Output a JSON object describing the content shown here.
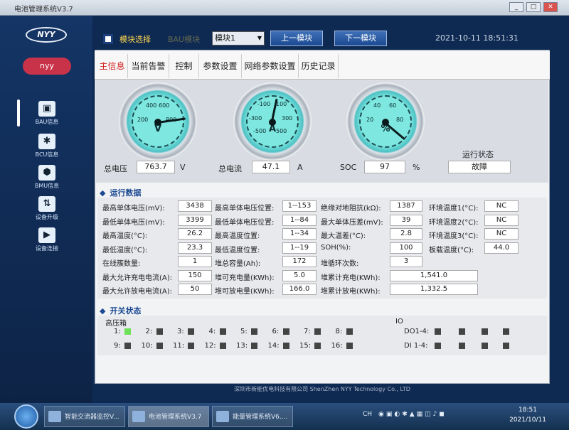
{
  "window": {
    "title": "电池管理系统V3.7"
  },
  "sidebar": {
    "logo": "NYY",
    "user": "nyy",
    "items": [
      {
        "label": "BAU信息",
        "icon": "cube-icon",
        "glyph": "▣"
      },
      {
        "label": "BCU信息",
        "icon": "molecule-icon",
        "glyph": "✱"
      },
      {
        "label": "BMU信息",
        "icon": "hexagon-cluster-icon",
        "glyph": "⬢"
      },
      {
        "label": "设备升级",
        "icon": "upgrade-arrows-icon",
        "glyph": "⇅"
      },
      {
        "label": "设备连接",
        "icon": "connect-icon",
        "glyph": "▶"
      }
    ]
  },
  "topbar": {
    "module_select_label": "模块选择",
    "bau_label": "BAU模块",
    "module_value": "模块1",
    "prev_button": "上一模块",
    "next_button": "下一模块",
    "datetime": "2021-10-11  18:51:31"
  },
  "tabs": [
    "主信息",
    "当前告警",
    "控制",
    "参数设置",
    "网络参数设置",
    "历史记录"
  ],
  "gauges": {
    "voltage": {
      "label": "总电压",
      "value": "763.7",
      "unit": "V",
      "gauge_unit": "V",
      "ticks": [
        "400",
        "600",
        "200",
        "800"
      ]
    },
    "current": {
      "label": "总电流",
      "value": "47.1",
      "unit": "A",
      "gauge_unit": "A",
      "ticks": [
        "-100",
        "100",
        "-300",
        "300",
        "-500",
        "500"
      ]
    },
    "soc": {
      "label": "SOC",
      "value": "97",
      "unit": "%",
      "gauge_unit": "%",
      "ticks": [
        "40",
        "60",
        "20",
        "80"
      ]
    },
    "status": {
      "label": "运行状态",
      "value": "故障"
    }
  },
  "run_data": {
    "title": "运行数据",
    "rows": [
      [
        {
          "l": "最高单体电压(mV):",
          "v": "3438"
        },
        {
          "l": "最高单体电压位置:",
          "v": "1--153"
        },
        {
          "l": "绝缘对地阻抗(kΩ):",
          "v": "1387"
        },
        {
          "l": "环境温度1(°C):",
          "v": "NC"
        }
      ],
      [
        {
          "l": "最低单体电压(mV):",
          "v": "3399"
        },
        {
          "l": "最低单体电压位置:",
          "v": "1--84"
        },
        {
          "l": "最大单体压差(mV):",
          "v": "39"
        },
        {
          "l": "环境温度2(°C):",
          "v": "NC"
        }
      ],
      [
        {
          "l": "最高温度(°C):",
          "v": "26.2"
        },
        {
          "l": "最高温度位置:",
          "v": "1--34"
        },
        {
          "l": "最大温差(°C):",
          "v": "2.8"
        },
        {
          "l": "环境温度3(°C):",
          "v": "NC"
        }
      ],
      [
        {
          "l": "最低温度(°C):",
          "v": "23.3"
        },
        {
          "l": "最低温度位置:",
          "v": "1--19"
        },
        {
          "l": "SOH(%):",
          "v": "100"
        },
        {
          "l": "板载温度(°C):",
          "v": "44.0"
        }
      ],
      [
        {
          "l": "在线簇数量:",
          "v": "1"
        },
        {
          "l": "堆总容量(Ah):",
          "v": "172"
        },
        {
          "l": "堆循环次数:",
          "v": "3"
        }
      ],
      [
        {
          "l": "最大允许充电电流(A):",
          "v": "150"
        },
        {
          "l": "堆可充电量(KWh):",
          "v": "5.0"
        },
        {
          "l": "堆累计充电(KWh):",
          "v": "1,541.0"
        }
      ],
      [
        {
          "l": "最大允许放电电流(A):",
          "v": "50"
        },
        {
          "l": "堆可放电量(KWh):",
          "v": "166.0"
        },
        {
          "l": "堆累计放电(KWh):",
          "v": "1,332.5"
        }
      ]
    ]
  },
  "switch_status": {
    "title": "开关状态",
    "hv_box": "高压箱",
    "io_label": "IO",
    "hv": [
      {
        "n": "1:",
        "on": true
      },
      {
        "n": "2:",
        "on": false
      },
      {
        "n": "3:",
        "on": false
      },
      {
        "n": "4:",
        "on": false
      },
      {
        "n": "5:",
        "on": false
      },
      {
        "n": "6:",
        "on": false
      },
      {
        "n": "7:",
        "on": false
      },
      {
        "n": "8:",
        "on": false
      },
      {
        "n": "9:",
        "on": false
      },
      {
        "n": "10:",
        "on": false
      },
      {
        "n": "11:",
        "on": false
      },
      {
        "n": "12:",
        "on": false
      },
      {
        "n": "13:",
        "on": false
      },
      {
        "n": "14:",
        "on": false
      },
      {
        "n": "15:",
        "on": false
      },
      {
        "n": "16:",
        "on": false
      }
    ],
    "do_label": "DO1-4:",
    "di_label": "DI 1-4:"
  },
  "footer": "深圳市新能优电科技有限公司 ShenZhen NYY Technology Co., LTD",
  "taskbar": {
    "tasks": [
      "智能交流器监控V...",
      "电池管理系统V3.7",
      "能量管理系统V6...."
    ],
    "lang": "CH",
    "time": "18:51",
    "date": "2021/10/11"
  }
}
